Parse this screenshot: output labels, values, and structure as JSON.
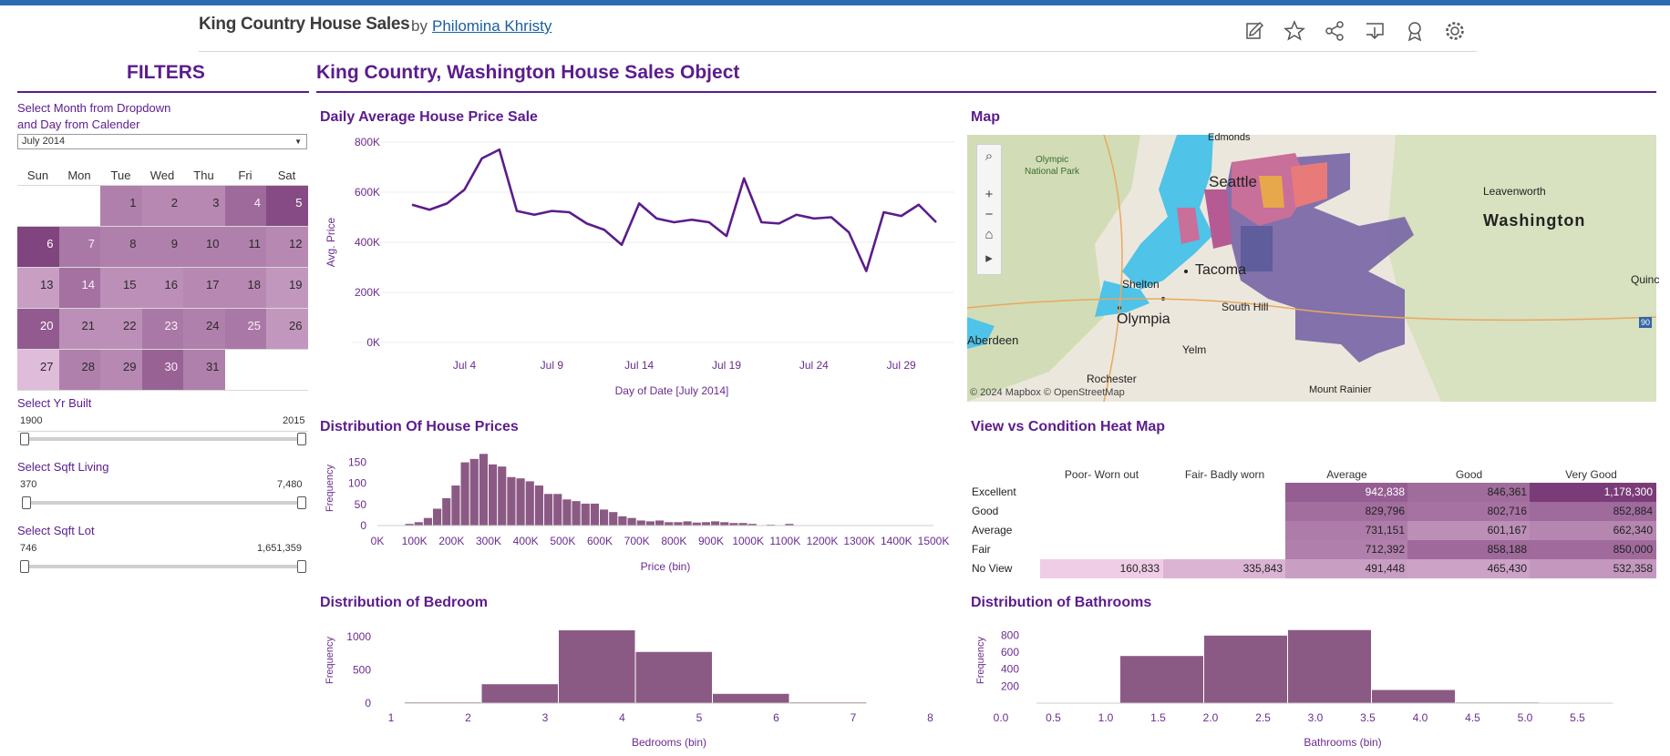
{
  "header": {
    "title": "King Country House Sales",
    "by": "by",
    "author": "Philomina Khristy",
    "tools": [
      "edit-icon",
      "star-icon",
      "share-icon",
      "download-icon",
      "badge-icon",
      "settings-icon"
    ]
  },
  "filters": {
    "title": "FILTERS",
    "month_label_line1": "Select Month from Dropdown",
    "month_label_line2": "and Day from Calender",
    "month_value": "July 2014",
    "days_of_week": [
      "Sun",
      "Mon",
      "Tue",
      "Wed",
      "Thu",
      "Fri",
      "Sat"
    ],
    "calendar_days": [
      "1",
      "2",
      "3",
      "4",
      "5",
      "6",
      "7",
      "8",
      "9",
      "10",
      "11",
      "12",
      "13",
      "14",
      "15",
      "16",
      "17",
      "18",
      "19",
      "20",
      "21",
      "22",
      "23",
      "24",
      "25",
      "26",
      "27",
      "28",
      "29",
      "30",
      "31"
    ],
    "calendar_first_weekday": 2,
    "calendar_intensity": [
      0.55,
      0.5,
      0.5,
      0.7,
      0.9,
      0.95,
      0.6,
      0.55,
      0.55,
      0.55,
      0.55,
      0.5,
      0.35,
      0.65,
      0.45,
      0.45,
      0.5,
      0.5,
      0.4,
      0.8,
      0.45,
      0.45,
      0.6,
      0.55,
      0.6,
      0.4,
      0.15,
      0.55,
      0.5,
      0.75,
      0.55
    ],
    "yr_built": {
      "label": "Select Yr Built",
      "min": "1900",
      "max": "2015"
    },
    "sqft_living": {
      "label": "Select Sqft Living",
      "min": "370",
      "max": "7,480"
    },
    "sqft_lot": {
      "label": "Select Sqft Lot",
      "min": "746",
      "max": "1,651,359"
    }
  },
  "main": {
    "title": "King Country, Washington House Sales Object"
  },
  "colors": {
    "purple": "#5b1c8c",
    "bar": "#8b5a84",
    "map_water": "#4fc3e8"
  },
  "daily": {
    "title": "Daily Average House Price Sale",
    "ylabel": "Avg. Price",
    "xlabel": "Day of Date [July 2014]",
    "yticks": [
      "0K",
      "200K",
      "400K",
      "600K",
      "800K"
    ],
    "xticks": [
      "Jul 4",
      "Jul 9",
      "Jul 14",
      "Jul 19",
      "Jul 24",
      "Jul 29"
    ]
  },
  "map": {
    "title": "Map",
    "attribution": "© 2024 Mapbox  © OpenStreetMap",
    "labels": {
      "edmonds": "Edmonds",
      "olympic": "Olympic",
      "national_park": "National Park",
      "seattle": "Seattle",
      "tacoma": "Tacoma",
      "shelton": "Shelton",
      "olympia": "Olympia",
      "south_hill": "South Hill",
      "aberdeen": "Aberdeen",
      "yelm": "Yelm",
      "rochester": "Rochester",
      "leavenworth": "Leavenworth",
      "washington": "Washington",
      "quincy": "Quinc",
      "mount_rainier": "Mount Rainier",
      "national_park2": "National Park",
      "route": "90"
    }
  },
  "price_hist": {
    "title": "Distribution Of House Prices",
    "ylabel": "Frequency",
    "xlabel": "Price (bin)",
    "yticks": [
      "0",
      "50",
      "100",
      "150"
    ],
    "xticks": [
      "0K",
      "100K",
      "200K",
      "300K",
      "400K",
      "500K",
      "600K",
      "700K",
      "800K",
      "900K",
      "1000K",
      "1100K",
      "1200K",
      "1300K",
      "1400K",
      "1500K"
    ]
  },
  "heatmap": {
    "title": "View vs Condition Heat Map",
    "columns": [
      "Poor- Worn out",
      "Fair- Badly worn",
      "Average",
      "Good",
      "Very Good"
    ],
    "rows": [
      {
        "label": "Excellent",
        "cells": [
          "",
          "",
          "942,838",
          "846,361",
          "1,178,300"
        ]
      },
      {
        "label": "Good",
        "cells": [
          "",
          "",
          "829,796",
          "802,716",
          "852,884"
        ]
      },
      {
        "label": "Average",
        "cells": [
          "",
          "",
          "731,151",
          "601,167",
          "662,340"
        ]
      },
      {
        "label": "Fair",
        "cells": [
          "",
          "",
          "712,392",
          "858,188",
          "850,000"
        ]
      },
      {
        "label": "No View",
        "cells": [
          "160,833",
          "335,843",
          "491,448",
          "465,430",
          "532,358"
        ]
      }
    ]
  },
  "bedroom": {
    "title": "Distribution of Bedroom",
    "ylabel": "Frequency",
    "xlabel": "Bedrooms (bin)",
    "yticks": [
      "0",
      "500",
      "1000"
    ],
    "xticks": [
      "1",
      "2",
      "3",
      "4",
      "5",
      "6",
      "7",
      "8"
    ]
  },
  "bathroom": {
    "title": "Distribution of Bathrooms",
    "ylabel": "Frequency",
    "xlabel": "Bathrooms (bin)",
    "yticks": [
      "200",
      "400",
      "600",
      "800"
    ],
    "xticks": [
      "0.0",
      "0.5",
      "1.0",
      "1.5",
      "2.0",
      "2.5",
      "3.0",
      "3.5",
      "4.0",
      "4.5",
      "5.0",
      "5.5"
    ]
  },
  "chart_data": [
    {
      "type": "line",
      "title": "Daily Average House Price Sale",
      "xlabel": "Day of Date [July 2014]",
      "ylabel": "Avg. Price",
      "ylim": [
        0,
        800000
      ],
      "x": [
        "Jul 1",
        "Jul 2",
        "Jul 3",
        "Jul 4",
        "Jul 5",
        "Jul 6",
        "Jul 7",
        "Jul 8",
        "Jul 9",
        "Jul 10",
        "Jul 11",
        "Jul 12",
        "Jul 13",
        "Jul 14",
        "Jul 15",
        "Jul 16",
        "Jul 17",
        "Jul 18",
        "Jul 19",
        "Jul 20",
        "Jul 21",
        "Jul 22",
        "Jul 23",
        "Jul 24",
        "Jul 25",
        "Jul 26",
        "Jul 27",
        "Jul 28",
        "Jul 29",
        "Jul 30",
        "Jul 31"
      ],
      "series": [
        {
          "values": [
            550000,
            530000,
            555000,
            610000,
            735000,
            770000,
            525000,
            510000,
            525000,
            520000,
            475000,
            450000,
            390000,
            555000,
            495000,
            480000,
            490000,
            480000,
            425000,
            655000,
            480000,
            475000,
            510000,
            495000,
            500000,
            440000,
            285000,
            520000,
            505000,
            550000,
            480000
          ]
        }
      ]
    },
    {
      "type": "bar",
      "title": "Distribution Of House Prices",
      "xlabel": "Price (bin)",
      "ylabel": "Frequency",
      "bin_width": 25000,
      "x_start": 75000,
      "values": [
        4,
        8,
        18,
        40,
        65,
        95,
        150,
        158,
        170,
        145,
        140,
        115,
        112,
        105,
        95,
        75,
        75,
        62,
        58,
        52,
        52,
        38,
        32,
        22,
        18,
        12,
        10,
        12,
        8,
        8,
        10,
        7,
        8,
        10,
        8,
        6,
        6,
        4,
        0,
        2,
        0,
        4
      ],
      "ylim": [
        0,
        175
      ]
    },
    {
      "type": "bar",
      "title": "View vs Condition Heat Map",
      "table": "heatmap"
    },
    {
      "type": "bar",
      "title": "Distribution of Bedroom",
      "xlabel": "Bedrooms (bin)",
      "ylabel": "Frequency",
      "categories": [
        "1",
        "2",
        "3",
        "4",
        "5",
        "6"
      ],
      "values": [
        12,
        285,
        1095,
        770,
        140,
        12
      ],
      "ylim": [
        0,
        1150
      ]
    },
    {
      "type": "bar",
      "title": "Distribution of Bathrooms",
      "xlabel": "Bathrooms (bin)",
      "ylabel": "Frequency",
      "categories": [
        "0.8",
        "1.6",
        "2.4",
        "3.2",
        "4.0"
      ],
      "values": [
        555,
        795,
        860,
        155,
        8
      ],
      "ylim": [
        0,
        900
      ]
    }
  ]
}
